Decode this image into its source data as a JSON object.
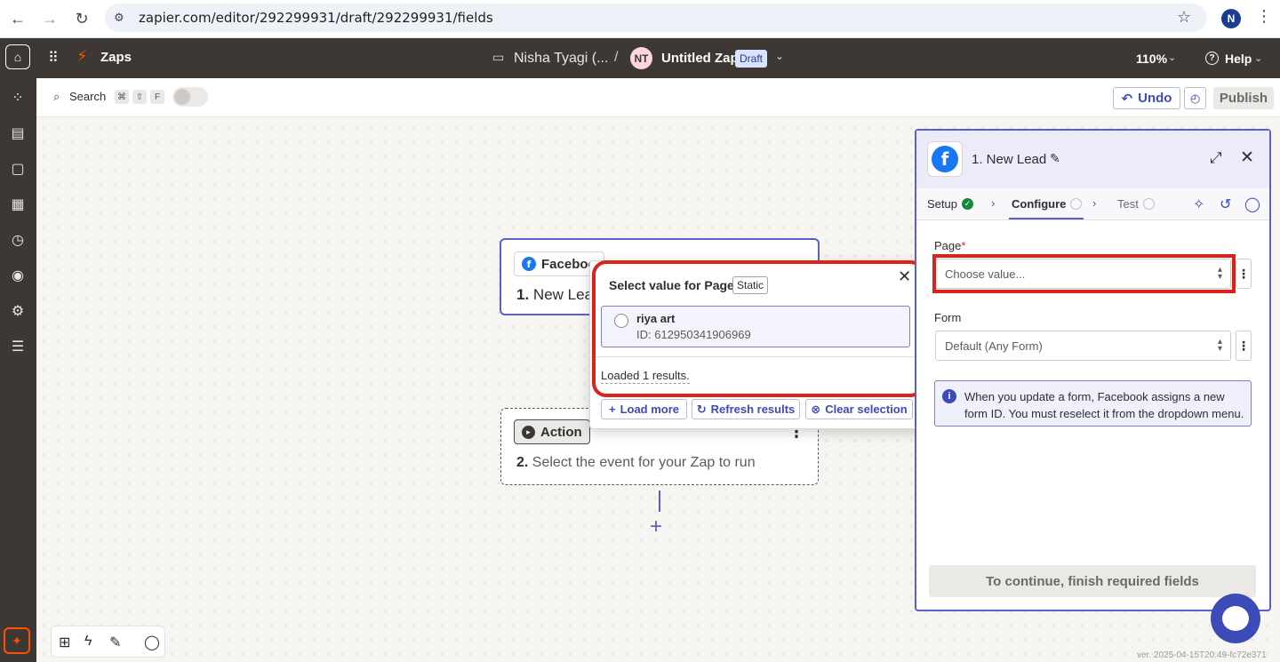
{
  "browser": {
    "url": "zapier.com/editor/292299931/draft/292299931/fields",
    "profile_initial": "N"
  },
  "topbar": {
    "app_label": "Zaps",
    "folder_name": "Nisha Tyagi (...",
    "separator": "/",
    "owner_initials": "NT",
    "zap_title": "Untitled Zap",
    "status_badge": "Draft",
    "zoom": "110%",
    "help_label": "Help"
  },
  "canvas_toolbar": {
    "search_label": "Search",
    "shortcut_keys": [
      "⌘",
      "⇧",
      "F"
    ],
    "undo_label": "Undo",
    "publish_label": "Publish"
  },
  "trigger_node": {
    "app_name": "Faceboo",
    "step_number": "1.",
    "step_title": "New Lea"
  },
  "action_node": {
    "chip_label": "Action",
    "step_number": "2.",
    "step_title": "Select the event for your Zap to run"
  },
  "popup": {
    "title": "Select value for Page",
    "badge": "Static",
    "option": {
      "name": "riya art",
      "id_text": "ID: 612950341906969"
    },
    "loaded_text": "Loaded 1 results.",
    "buttons": {
      "load_more": "Load more",
      "refresh": "Refresh results",
      "clear": "Clear selection"
    }
  },
  "panel": {
    "title": "1. New Lead",
    "tabs": {
      "setup": "Setup",
      "configure": "Configure",
      "test": "Test"
    },
    "page_field": {
      "label": "Page",
      "required_mark": "*",
      "placeholder": "Choose value..."
    },
    "form_field": {
      "label": "Form",
      "value": "Default (Any Form)"
    },
    "info_text": "When you update a form, Facebook assigns a new form ID. You must reselect it from the dropdown menu.",
    "continue_label": "To continue, finish required fields"
  },
  "footer": {
    "version": "ver. 2025-04-15T20:49-fc72e371"
  },
  "colors": {
    "brand_orange": "#ff4f00",
    "accent_blue": "#5a5fcf",
    "highlight_red": "#d8241c",
    "facebook_blue": "#1877f2"
  }
}
